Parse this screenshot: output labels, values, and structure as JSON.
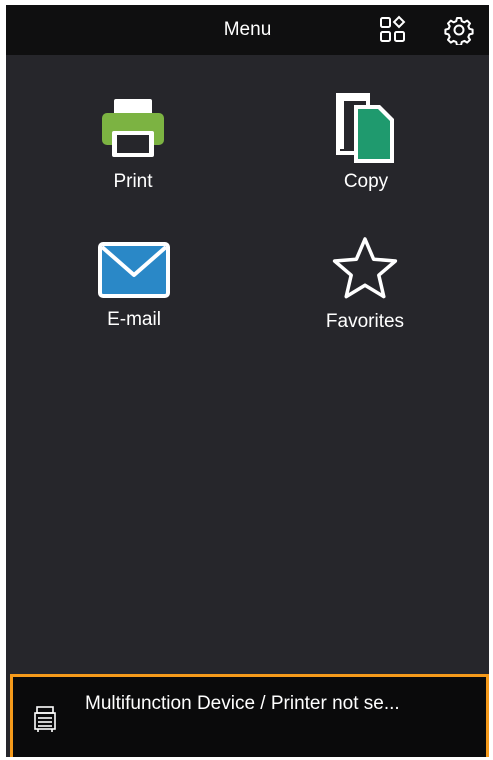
{
  "header": {
    "title": "Menu",
    "layout_icon": "grid-shapes-icon",
    "settings_icon": "gear-icon"
  },
  "menu": {
    "items": [
      {
        "label": "Print",
        "icon": "printer-icon"
      },
      {
        "label": "Copy",
        "icon": "copy-icon"
      },
      {
        "label": "E-mail",
        "icon": "envelope-icon"
      },
      {
        "label": "Favorites",
        "icon": "star-icon"
      }
    ]
  },
  "footer": {
    "device_text": "Multifunction Device / Printer not se...",
    "device_icon": "printer-device-icon"
  },
  "colors": {
    "background": "#26262b",
    "header": "#0f0f10",
    "footer_border": "#f59a1b",
    "print_green": "#7cb342",
    "copy_green": "#1f9a6e",
    "mail_blue": "#2a88c7"
  }
}
